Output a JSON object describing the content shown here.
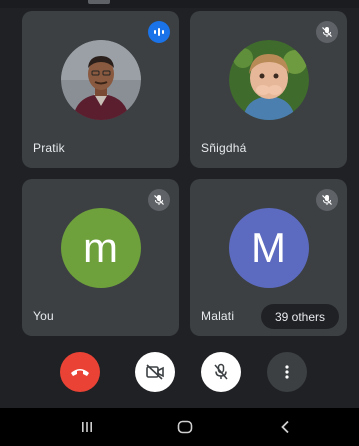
{
  "participants": [
    {
      "name": "Pratik",
      "status_icon": "speaking-indicator-icon",
      "avatar_type": "photo"
    },
    {
      "name": "Sñigdhá",
      "status_icon": "mic-off-icon",
      "avatar_type": "photo"
    },
    {
      "name": "You",
      "initial": "m",
      "avatar_color": "#6ea03c",
      "status_icon": "mic-off-icon"
    },
    {
      "name": "Malati",
      "initial": "M",
      "avatar_color": "#5c6bc0",
      "status_icon": "mic-off-icon"
    }
  ],
  "others_label": "39 others",
  "controls": [
    {
      "icon": "end-call-icon",
      "color": "#ea4335"
    },
    {
      "icon": "camera-off-icon",
      "color": "#ffffff"
    },
    {
      "icon": "mic-off-icon",
      "color": "#ffffff"
    },
    {
      "icon": "more-vert-icon",
      "color": "#3c4043"
    }
  ],
  "nav": [
    {
      "icon": "recent-apps-icon"
    },
    {
      "icon": "home-icon"
    },
    {
      "icon": "back-icon"
    }
  ],
  "colors": {
    "background": "#202124",
    "tile": "#3c4043",
    "speaking": "#1a73e8",
    "muted_badge": "#5f6368"
  }
}
